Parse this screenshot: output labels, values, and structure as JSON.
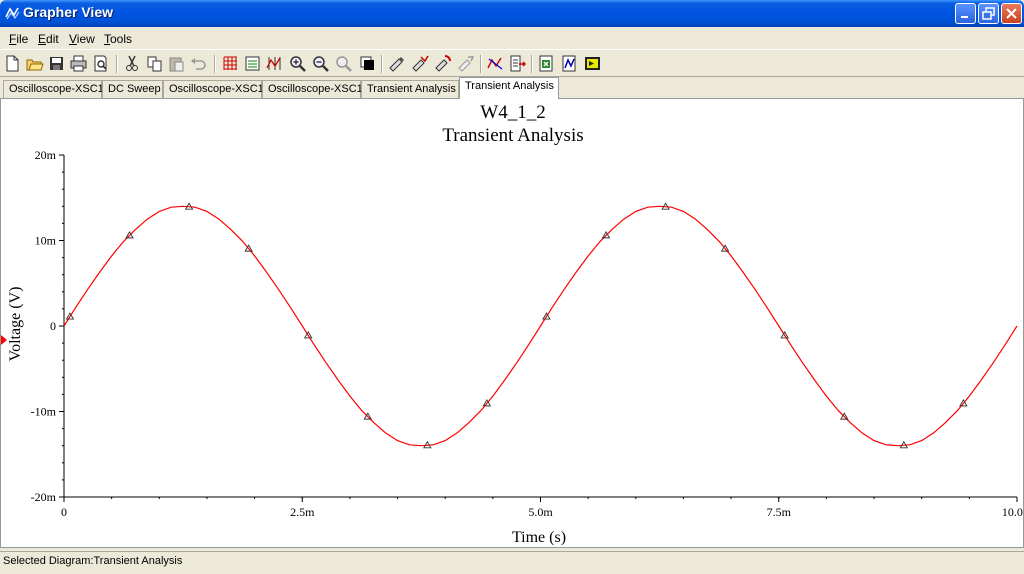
{
  "window": {
    "title": "Grapher View"
  },
  "menu": [
    {
      "accel": "F",
      "rest": "ile"
    },
    {
      "accel": "E",
      "rest": "dit"
    },
    {
      "accel": "V",
      "rest": "iew"
    },
    {
      "accel": "T",
      "rest": "ools"
    }
  ],
  "toolbar_icons": [
    "new-icon",
    "open-icon",
    "save-icon",
    "print-icon",
    "print-preview-icon",
    "cut-icon",
    "copy-icon",
    "paste-icon",
    "undo-icon",
    "grid-icon",
    "legend-icon",
    "cursors-icon",
    "zoom-in-icon",
    "zoom-out-icon",
    "zoom-full-icon",
    "reverse-colors-icon",
    "properties-icon",
    "trace-icon",
    "overlay-icon",
    "traces-icon",
    "add-trace-icon",
    "export-icon",
    "export-excel-icon",
    "export-mathcad-icon",
    "export-labview-icon"
  ],
  "tabs": [
    {
      "label": "Oscilloscope-XSC1",
      "active": false
    },
    {
      "label": "DC Sweep",
      "active": false
    },
    {
      "label": "Oscilloscope-XSC1",
      "active": false
    },
    {
      "label": "Oscilloscope-XSC1",
      "active": false
    },
    {
      "label": "Transient Analysis",
      "active": false
    },
    {
      "label": "Transient Analysis",
      "active": true
    }
  ],
  "status": {
    "text": "Selected Diagram:Transient Analysis"
  },
  "colors": {
    "trace": "#ff0000",
    "titlebar": "#0054e3"
  },
  "chart_data": {
    "type": "line",
    "title": "W4_1_2",
    "subtitle": "Transient Analysis",
    "xlabel": "Time (s)",
    "ylabel": "Voltage (V)",
    "xlim": [
      0,
      10.0
    ],
    "ylim": [
      -20,
      20
    ],
    "x_unit": "ms",
    "y_unit": "mV",
    "xticks": [
      {
        "value": 0,
        "label": "0"
      },
      {
        "value": 2.5,
        "label": "2.5m"
      },
      {
        "value": 5.0,
        "label": "5.0m"
      },
      {
        "value": 7.5,
        "label": "7.5m"
      },
      {
        "value": 10.0,
        "label": "10.0m"
      }
    ],
    "yticks": [
      {
        "value": 20,
        "label": "20m"
      },
      {
        "value": 10,
        "label": "10m"
      },
      {
        "value": 0,
        "label": "0"
      },
      {
        "value": -10,
        "label": "-10m"
      },
      {
        "value": -20,
        "label": "-20m"
      }
    ],
    "grid": false,
    "series": [
      {
        "color": "#ff0000",
        "marker": "triangle",
        "x": [
          0.0,
          0.125,
          0.25,
          0.375,
          0.5,
          0.625,
          0.75,
          0.875,
          1.0,
          1.125,
          1.25,
          1.375,
          1.5,
          1.625,
          1.75,
          1.875,
          2.0,
          2.125,
          2.25,
          2.375,
          2.5,
          2.625,
          2.75,
          2.875,
          3.0,
          3.125,
          3.25,
          3.375,
          3.5,
          3.625,
          3.75,
          3.875,
          4.0,
          4.125,
          4.25,
          4.375,
          4.5,
          4.625,
          4.75,
          4.875,
          5.0,
          5.125,
          5.25,
          5.375,
          5.5,
          5.625,
          5.75,
          5.875,
          6.0,
          6.125,
          6.25,
          6.375,
          6.5,
          6.625,
          6.75,
          6.875,
          7.0,
          7.125,
          7.25,
          7.375,
          7.5,
          7.625,
          7.75,
          7.875,
          8.0,
          8.125,
          8.25,
          8.375,
          8.5,
          8.625,
          8.75,
          8.875,
          9.0,
          9.125,
          9.25,
          9.375,
          9.5,
          9.625,
          9.75,
          9.875,
          10.0
        ],
        "y": [
          0.0,
          2.2,
          4.3,
          6.3,
          8.2,
          9.9,
          11.3,
          12.5,
          13.4,
          13.9,
          14.0,
          13.9,
          13.4,
          12.5,
          11.3,
          9.9,
          8.2,
          6.3,
          4.3,
          2.2,
          0.0,
          -2.2,
          -4.3,
          -6.3,
          -8.2,
          -9.9,
          -11.3,
          -12.5,
          -13.4,
          -13.9,
          -14.0,
          -13.9,
          -13.4,
          -12.5,
          -11.3,
          -9.9,
          -8.2,
          -6.3,
          -4.3,
          -2.2,
          0.0,
          2.2,
          4.3,
          6.3,
          8.2,
          9.9,
          11.3,
          12.5,
          13.4,
          13.9,
          14.0,
          13.9,
          13.4,
          12.5,
          11.3,
          9.9,
          8.2,
          6.3,
          4.3,
          2.2,
          0.0,
          -2.2,
          -4.3,
          -6.3,
          -8.2,
          -9.9,
          -11.3,
          -12.5,
          -13.4,
          -13.9,
          -14.0,
          -13.9,
          -13.4,
          -12.5,
          -11.3,
          -9.9,
          -8.2,
          -6.3,
          -4.3,
          -2.2,
          0.0
        ],
        "markers_x": [
          0.0625,
          0.6875,
          1.3125,
          1.9375,
          2.5625,
          3.1875,
          3.8125,
          4.4375,
          5.0625,
          5.6875,
          6.3125,
          6.9375,
          7.5625,
          8.1875,
          8.8125,
          9.4375
        ]
      }
    ]
  }
}
